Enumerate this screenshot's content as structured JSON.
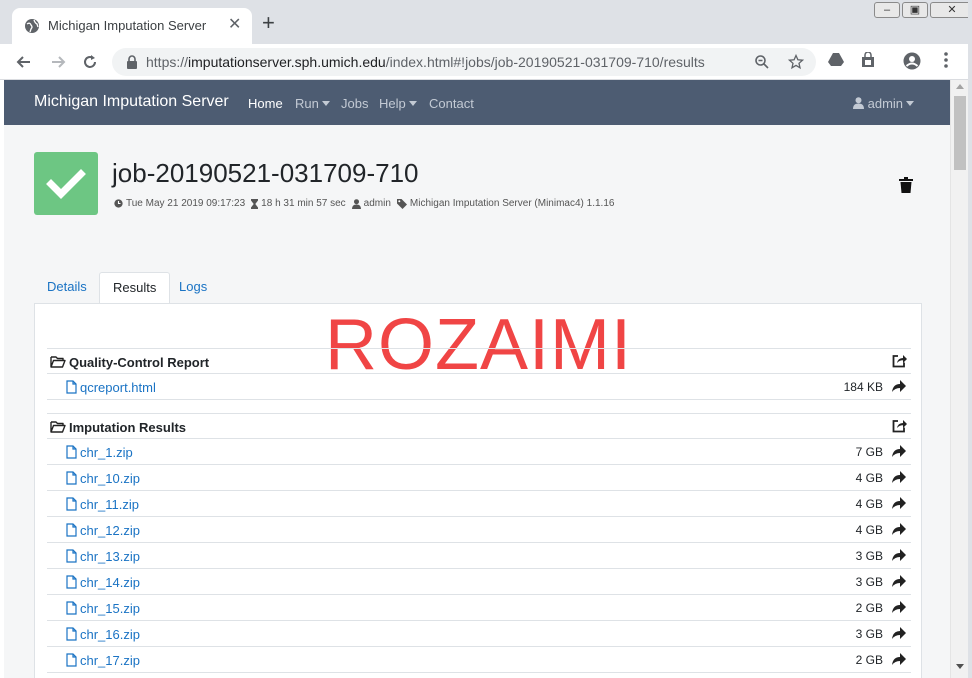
{
  "browser": {
    "tab_title": "Michigan Imputation Server",
    "url_scheme": "https://",
    "url_host": "imputationserver.sph.umich.edu",
    "url_path": "/index.html#!jobs/job-20190521-031709-710/results",
    "new_tab": "+",
    "close_tab": "✕"
  },
  "navbar": {
    "brand": "Michigan Imputation Server",
    "items": [
      {
        "label": "Home",
        "active": true
      },
      {
        "label": "Run",
        "dropdown": true
      },
      {
        "label": "Jobs"
      },
      {
        "label": "Help",
        "dropdown": true
      },
      {
        "label": "Contact"
      }
    ],
    "user": "admin"
  },
  "job": {
    "title": "job-20190521-031709-710",
    "submitted": "Tue May 21 2019 09:17:23",
    "duration": "18 h 31 min 57 sec",
    "user": "admin",
    "application": "Michigan Imputation Server (Minimac4) 1.1.16",
    "status_color": "#6dc683"
  },
  "tabs": [
    "Details",
    "Results",
    "Logs"
  ],
  "watermark": "ROZAIMI",
  "sections": [
    {
      "title": "Quality-Control Report",
      "files": [
        {
          "name": "qcreport.html",
          "size": "184 KB"
        }
      ]
    },
    {
      "title": "Imputation Results",
      "files": [
        {
          "name": "chr_1.zip",
          "size": "7 GB"
        },
        {
          "name": "chr_10.zip",
          "size": "4 GB"
        },
        {
          "name": "chr_11.zip",
          "size": "4 GB"
        },
        {
          "name": "chr_12.zip",
          "size": "4 GB"
        },
        {
          "name": "chr_13.zip",
          "size": "3 GB"
        },
        {
          "name": "chr_14.zip",
          "size": "3 GB"
        },
        {
          "name": "chr_15.zip",
          "size": "2 GB"
        },
        {
          "name": "chr_16.zip",
          "size": "3 GB"
        },
        {
          "name": "chr_17.zip",
          "size": "2 GB"
        }
      ]
    }
  ],
  "colors": {
    "navbar": "#4d5c72",
    "link": "#1a73c4",
    "watermark": "#f04545"
  }
}
